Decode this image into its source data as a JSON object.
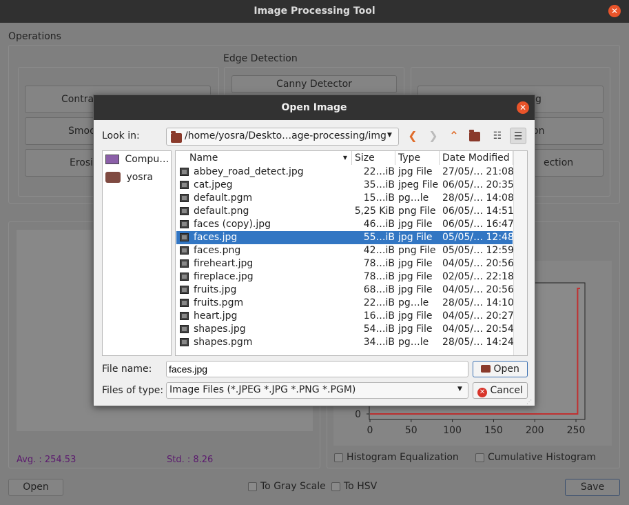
{
  "window": {
    "title": "Image Processing Tool"
  },
  "main": {
    "operations_label": "Operations",
    "edge_detection_label": "Edge Detection",
    "canny_button": "Canny Detector",
    "left_buttons": [
      "Contra",
      "Smoo",
      "Erosi"
    ],
    "right_buttons": [
      "g",
      "on",
      "ection"
    ],
    "avg": "Avg. : 254.53",
    "std": "Std. : 8.26",
    "hist_eq": "Histogram Equalization",
    "cum_hist": "Cumulative Histogram",
    "open": "Open",
    "gray": "To Gray Scale",
    "hsv": "To HSV",
    "save": "Save"
  },
  "chart_data": {
    "type": "line",
    "x_ticks": [
      "0",
      "50",
      "100",
      "150",
      "200",
      "250"
    ],
    "y_ticks": [
      "0"
    ],
    "xlim": [
      0,
      255
    ],
    "series": [
      {
        "x": [
          0,
          252,
          252,
          255
        ],
        "y": [
          0,
          0,
          1,
          1
        ]
      }
    ],
    "color": "#c03030"
  },
  "dialog": {
    "title": "Open Image",
    "look_in_label": "Look in:",
    "path": "/home/yosra/Deskto…age-processing/img",
    "sidebar": [
      "Compu…",
      "yosra"
    ],
    "columns": [
      "Name",
      "Size",
      "Type",
      "Date Modified"
    ],
    "files": [
      {
        "name": "abbey_road_detect.jpg",
        "size": "22…iB",
        "type": "jpg File",
        "date": "27/05/… 21:08"
      },
      {
        "name": "cat.jpeg",
        "size": "35…iB",
        "type": "jpeg File",
        "date": "06/05/… 20:35"
      },
      {
        "name": "default.pgm",
        "size": "15…iB",
        "type": "pg…le",
        "date": "28/05/… 14:08"
      },
      {
        "name": "default.png",
        "size": "5,25 KiB",
        "type": "png File",
        "date": "06/05/… 14:51"
      },
      {
        "name": "faces (copy).jpg",
        "size": "46…iB",
        "type": "jpg File",
        "date": "06/05/… 16:47"
      },
      {
        "name": "faces.jpg",
        "size": "55…iB",
        "type": "jpg File",
        "date": "05/05/… 12:48",
        "selected": true
      },
      {
        "name": "faces.png",
        "size": "42…iB",
        "type": "png File",
        "date": "05/05/… 12:59"
      },
      {
        "name": "fireheart.jpg",
        "size": "78…iB",
        "type": "jpg File",
        "date": "04/05/… 20:56"
      },
      {
        "name": "fireplace.jpg",
        "size": "78…iB",
        "type": "jpg File",
        "date": "02/05/… 22:18"
      },
      {
        "name": "fruits.jpg",
        "size": "68…iB",
        "type": "jpg File",
        "date": "04/05/… 20:56"
      },
      {
        "name": "fruits.pgm",
        "size": "22…iB",
        "type": "pg…le",
        "date": "28/05/… 14:10"
      },
      {
        "name": "heart.jpg",
        "size": "16…iB",
        "type": "jpg File",
        "date": "04/05/… 20:27"
      },
      {
        "name": "shapes.jpg",
        "size": "54…iB",
        "type": "jpg File",
        "date": "04/05/… 20:54"
      },
      {
        "name": "shapes.pgm",
        "size": "34…iB",
        "type": "pg…le",
        "date": "28/05/… 14:24"
      }
    ],
    "file_name_label": "File name:",
    "file_name_value": "faces.jpg",
    "files_of_type_label": "Files of type:",
    "filter": "Image Files (*.JPEG *.JPG *.PNG *.PGM)",
    "open_button": "Open",
    "cancel_button": "Cancel"
  }
}
